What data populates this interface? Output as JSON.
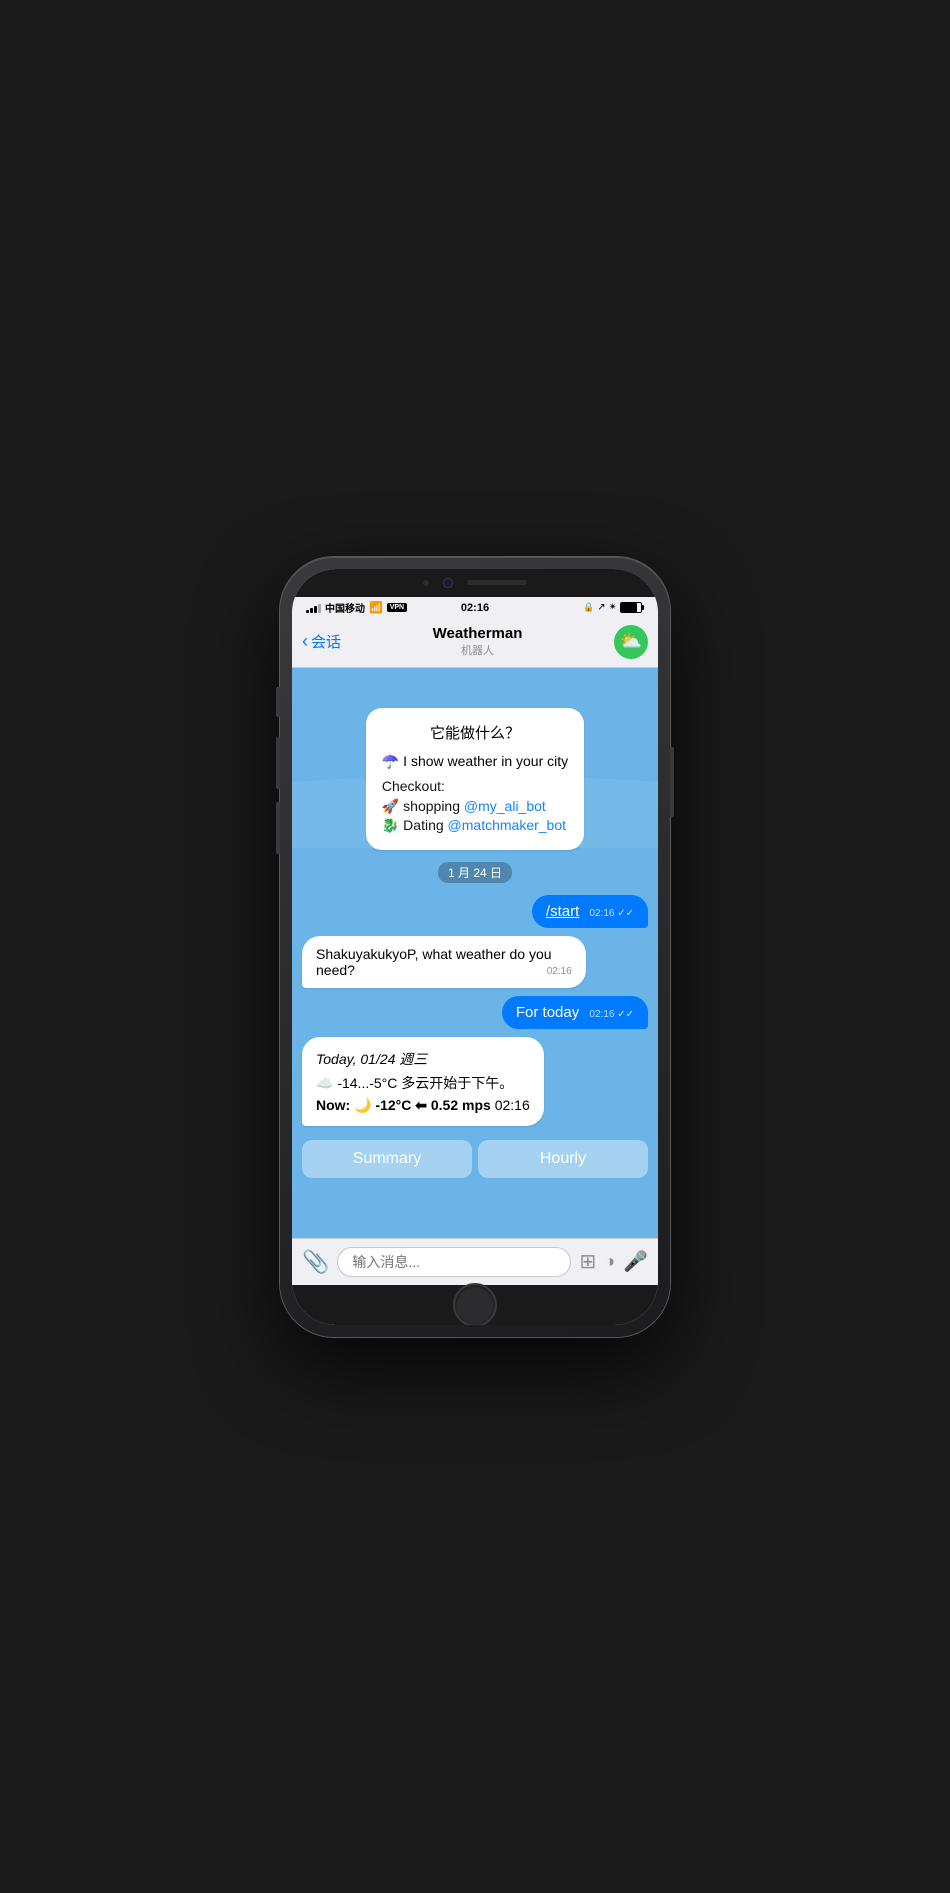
{
  "phone": {
    "status_bar": {
      "carrier": "中国移动",
      "vpn": "VPN",
      "time": "02:16",
      "lock_icon": "🔒",
      "location_icon": "↗",
      "bluetooth_icon": "✴"
    },
    "nav": {
      "back_text": "会话",
      "title": "Weatherman",
      "subtitle": "机器人",
      "bot_icon": "⛅"
    },
    "chat": {
      "welcome_bubble": {
        "title": "它能做什么？",
        "desc_icon": "☂️",
        "desc_text": " I show weather in your city",
        "checkout_label": "Checkout:",
        "item1_icon": "🚀",
        "item1_text": " shopping ",
        "item1_link": "@my_ali_bot",
        "item2_icon": "🐉",
        "item2_text": " Dating ",
        "item2_link": "@matchmaker_bot"
      },
      "date_divider": "1 月 24 日",
      "user_msg1": {
        "text": "/start",
        "time": "02:16",
        "checks": "✓✓"
      },
      "bot_msg1": {
        "text": "ShakuyakukyoP, what weather do you need?",
        "time": "02:16"
      },
      "user_msg2": {
        "text": "For today",
        "time": "02:16",
        "checks": "✓✓"
      },
      "weather_msg": {
        "date_line": "Today, 01/24 週三",
        "temp_line": "☁️  -14...-5°C 多云开始于下午。",
        "now_line": "Now: 🌙 -12°C ⬅ 0.52 mps",
        "time": "02:16"
      },
      "quick_replies": {
        "summary": "Summary",
        "hourly": "Hourly"
      }
    },
    "input_bar": {
      "placeholder": "输入消息...",
      "attach_icon": "📎",
      "emoji_icon": "⊞",
      "sticker_icon": "◑",
      "mic_icon": "🎤"
    }
  }
}
